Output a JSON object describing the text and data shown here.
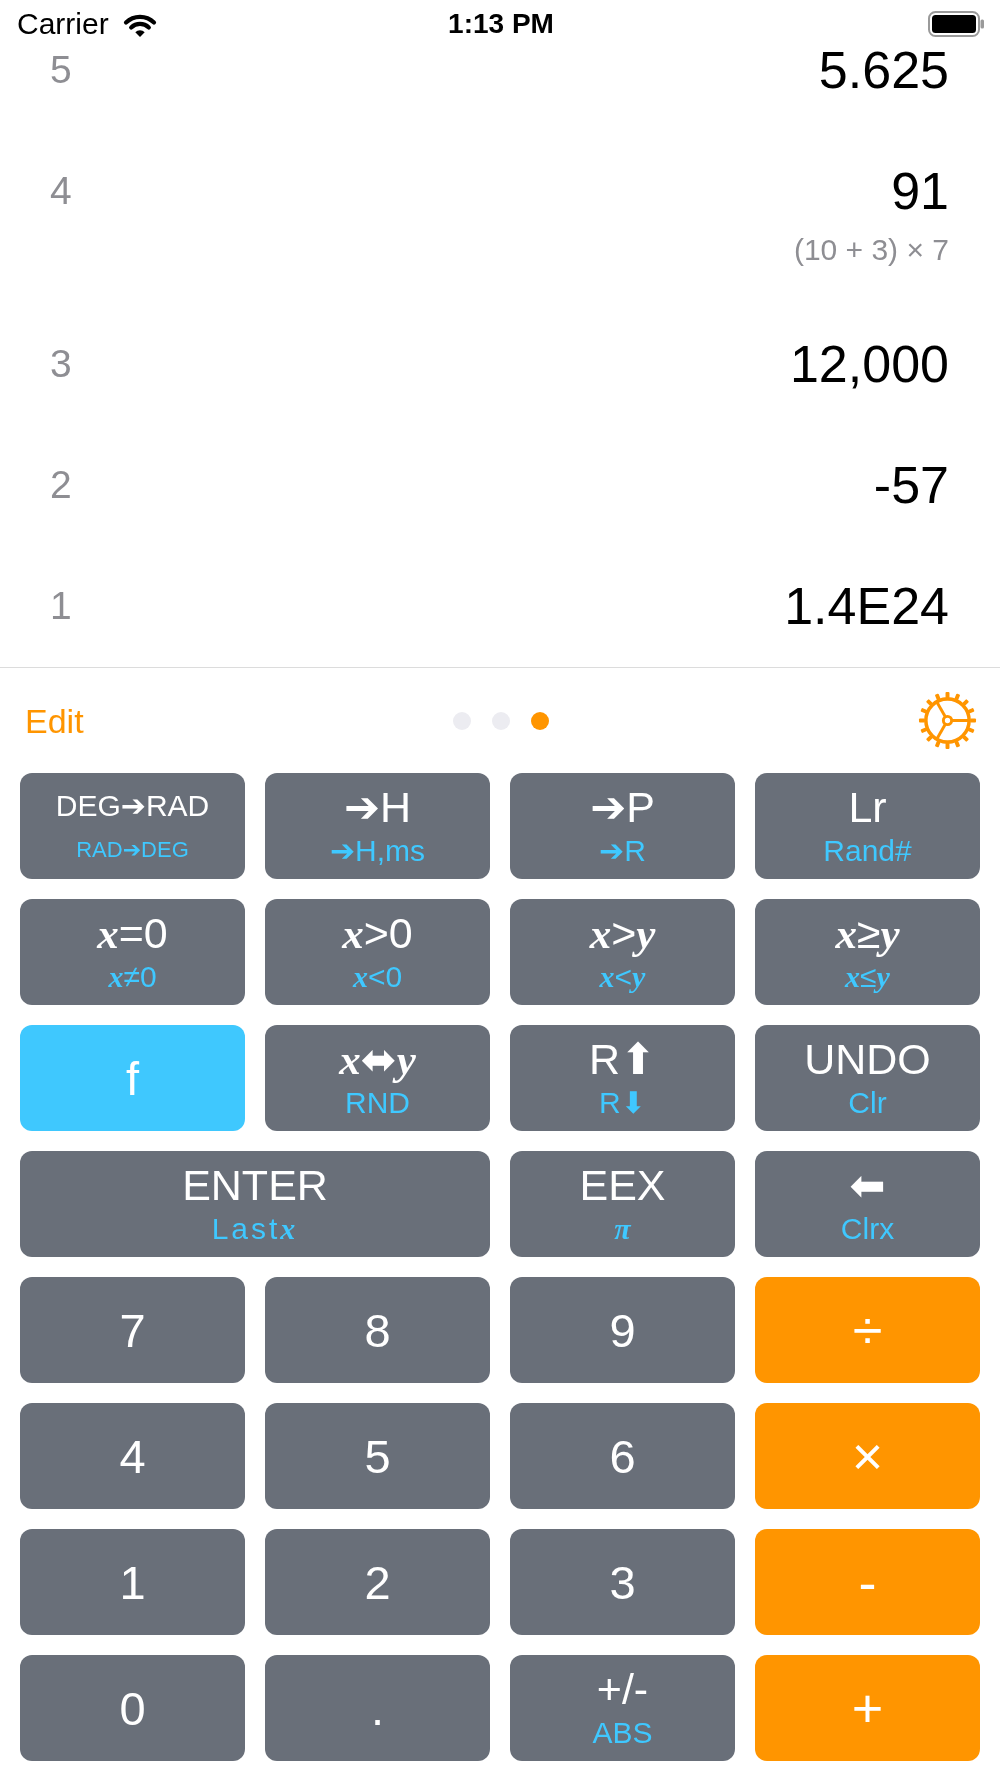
{
  "status_bar": {
    "carrier": "Carrier",
    "time": "1:13 PM"
  },
  "stack": [
    {
      "index": "5",
      "value": "5.625"
    },
    {
      "index": "4",
      "value": "91",
      "expression": "(10 + 3) × 7"
    },
    {
      "index": "3",
      "value": "12,000"
    },
    {
      "index": "2",
      "value": "-57"
    },
    {
      "index": "1",
      "value": "1.4E24"
    }
  ],
  "toolbar": {
    "edit": "Edit",
    "pages": [
      {
        "selected": false
      },
      {
        "selected": false
      },
      {
        "selected": true
      }
    ]
  },
  "keypad": [
    {
      "kind": "key",
      "label": "DEG➔RAD",
      "sub": "RAD➔DEG"
    },
    {
      "kind": "key",
      "label": "➔H",
      "sub": "➔H,ms"
    },
    {
      "kind": "key",
      "label": "➔P",
      "sub": "➔R"
    },
    {
      "kind": "key",
      "label": "Lr",
      "sub": "Rand#"
    },
    {
      "kind": "key",
      "label": "*x*=0",
      "sub": "*x*≠0"
    },
    {
      "kind": "key",
      "label": "*x*>0",
      "sub": "*x*<0"
    },
    {
      "kind": "key",
      "label": "*x*>*y*",
      "sub": "*x*<*y*"
    },
    {
      "kind": "key",
      "label": "*x*≥*y*",
      "sub": "*x*≤*y*"
    },
    {
      "kind": "shift",
      "label": "f"
    },
    {
      "kind": "key",
      "label": "*x*⬌*y*",
      "sub": "RND"
    },
    {
      "kind": "key",
      "label": "R⬆",
      "sub": "R⬇"
    },
    {
      "kind": "key",
      "label": "UNDO",
      "sub": "Clr"
    },
    {
      "kind": "enter",
      "label": "ENTER",
      "sub": "Last",
      "sub_variable": "x"
    },
    {
      "kind": "key",
      "label": "EEX",
      "sub_variable": "π"
    },
    {
      "kind": "key",
      "label": "⬅",
      "sub": "Clrx"
    },
    {
      "kind": "key",
      "label": "7"
    },
    {
      "kind": "key",
      "label": "8"
    },
    {
      "kind": "key",
      "label": "9"
    },
    {
      "kind": "operator",
      "label": "÷"
    },
    {
      "kind": "key",
      "label": "4"
    },
    {
      "kind": "key",
      "label": "5"
    },
    {
      "kind": "key",
      "label": "6"
    },
    {
      "kind": "operator",
      "label": "×"
    },
    {
      "kind": "key",
      "label": "1"
    },
    {
      "kind": "key",
      "label": "2"
    },
    {
      "kind": "key",
      "label": "3"
    },
    {
      "kind": "operator",
      "label": "-"
    },
    {
      "kind": "key",
      "label": "0"
    },
    {
      "kind": "key",
      "label": "."
    },
    {
      "kind": "key",
      "label": "+/-",
      "sub": "ABS"
    },
    {
      "kind": "operator",
      "label": "+"
    }
  ]
}
